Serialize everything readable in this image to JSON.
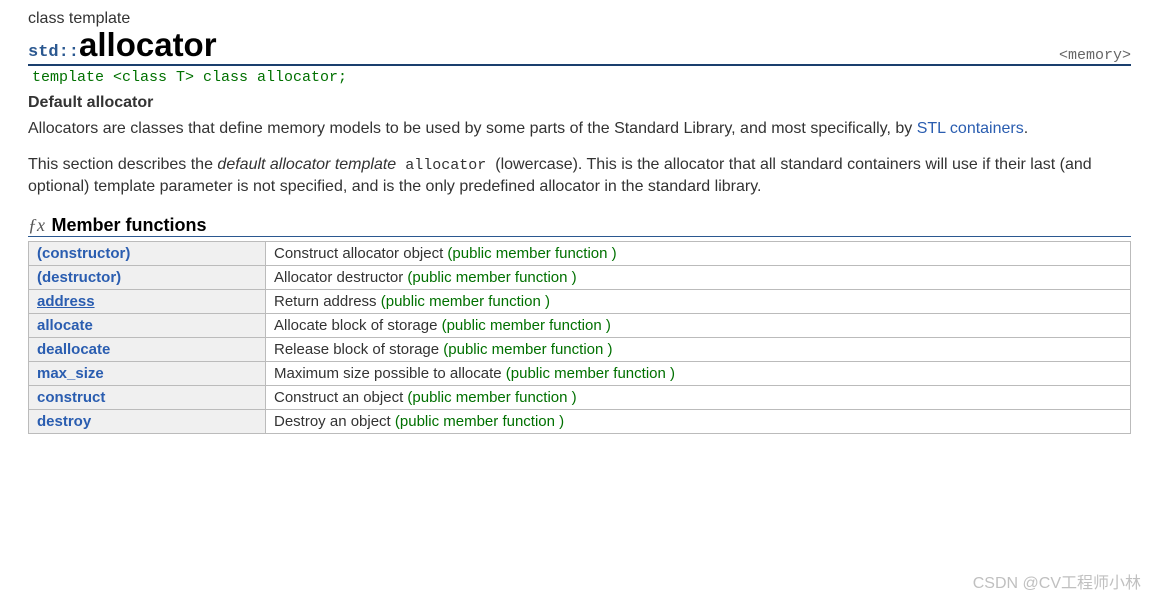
{
  "kind": "class template",
  "namespace": "std::",
  "title": "allocator",
  "header": "<memory>",
  "signature": "template <class T> class allocator;",
  "sub_heading": "Default allocator",
  "para1_pre": "Allocators are classes that define memory models to be used by some parts of the Standard Library, and most specifically, by ",
  "para1_link": "STL containers",
  "para1_post": ".",
  "para2_a": "This section describes the ",
  "para2_em": "default allocator template",
  "para2_mono": " allocator ",
  "para2_b": "(lowercase). This is the allocator that all standard containers will use if their last (and optional) template parameter is not specified, and is the only predefined allocator in the standard library.",
  "section_label": "Member functions",
  "fx": "ƒx",
  "cat_label": "(public member function )",
  "members": [
    {
      "name": "(constructor)",
      "desc": "Construct allocator object",
      "underline": false
    },
    {
      "name": "(destructor)",
      "desc": "Allocator destructor",
      "underline": false
    },
    {
      "name": "address",
      "desc": "Return address",
      "underline": true
    },
    {
      "name": "allocate",
      "desc": "Allocate block of storage",
      "underline": false
    },
    {
      "name": "deallocate",
      "desc": "Release block of storage",
      "underline": false
    },
    {
      "name": "max_size",
      "desc": "Maximum size possible to allocate",
      "underline": false
    },
    {
      "name": "construct",
      "desc": "Construct an object",
      "underline": false
    },
    {
      "name": "destroy",
      "desc": "Destroy an object",
      "underline": false
    }
  ],
  "watermark": "CSDN @CV工程师小林"
}
